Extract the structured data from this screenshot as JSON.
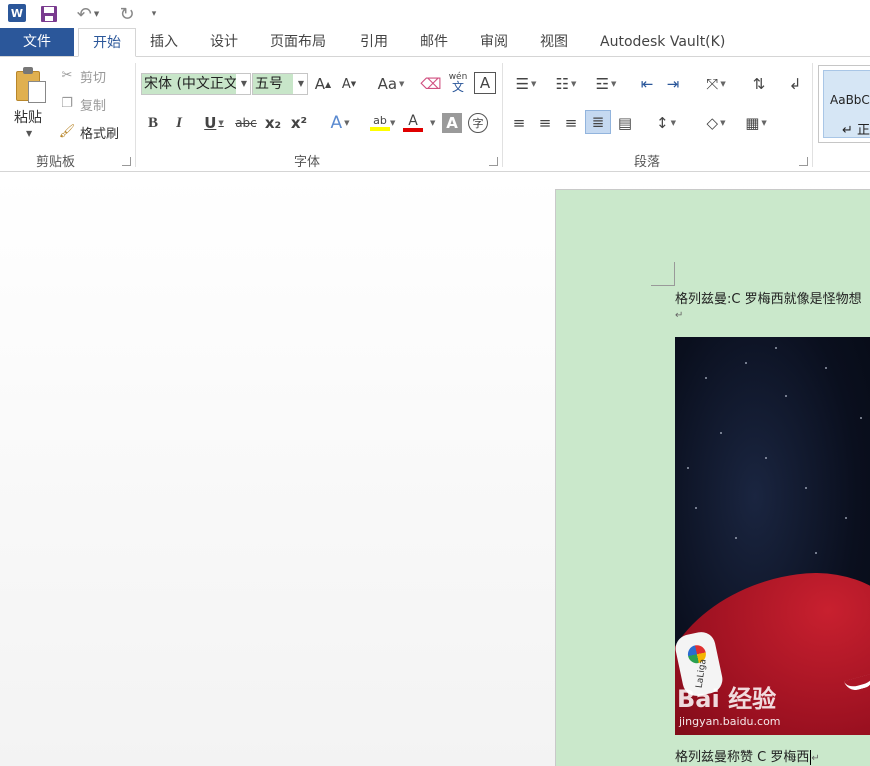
{
  "qat": {
    "app_icon": "word-icon",
    "app_letter": "W",
    "save_icon": "save-icon",
    "undo_icon": "undo-icon",
    "redo_icon": "redo-icon",
    "more_icon": "customize-qat-icon"
  },
  "tabs": {
    "file": "文件",
    "home": "开始",
    "insert": "插入",
    "design": "设计",
    "layout": "页面布局",
    "references": "引用",
    "mailings": "邮件",
    "review": "审阅",
    "view": "视图",
    "vault": "Autodesk Vault(K)"
  },
  "clipboard": {
    "paste": "粘贴",
    "cut": "剪切",
    "copy": "复制",
    "format_painter": "格式刷",
    "group_label": "剪贴板"
  },
  "font": {
    "font_name": "宋体 (中文正文",
    "font_size": "五号",
    "grow": "A",
    "shrink": "A",
    "change_case": "Aa",
    "bold": "B",
    "italic": "I",
    "underline": "U",
    "strike": "abc",
    "subscript": "x₂",
    "superscript": "x²",
    "text_effects": "A",
    "highlight": "ab",
    "font_color": "A",
    "char_shading": "A",
    "enclose": "字",
    "phonetic_top": "wén",
    "phonetic_bottom": "文",
    "char_border": "A",
    "group_label": "字体"
  },
  "paragraph": {
    "group_label": "段落"
  },
  "styles": {
    "sample": "AaBbCcDd",
    "name": "↵ 正文"
  },
  "document": {
    "line1": "格列兹曼:C 罗梅西就像是怪物想",
    "para_mark": "↵",
    "watermark_logo": "Bai 经验",
    "watermark_url": "jingyan.baidu.com",
    "badge_text": "LaLiga",
    "caption": "格列兹曼称赞 C 罗梅西",
    "caption_mark": "↵"
  },
  "colors": {
    "file_tab": "#2b579a",
    "page_bg": "#cae8cb",
    "highlight_bar": "#ffff00",
    "font_color_bar": "#e00000"
  }
}
